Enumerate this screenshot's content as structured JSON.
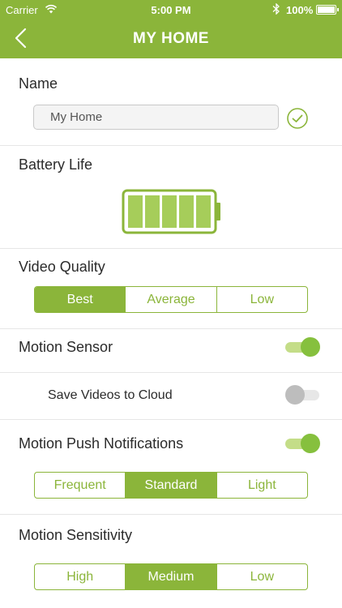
{
  "status_bar": {
    "carrier": "Carrier",
    "time": "5:00 PM",
    "battery_percent": "100%"
  },
  "header": {
    "title": "MY HOME",
    "back_icon": "chevron-left-icon"
  },
  "name_section": {
    "label": "Name",
    "value": "My Home",
    "confirm_icon": "check-circle-icon"
  },
  "battery_section": {
    "label": "Battery Life",
    "level_bars": 5,
    "filled_bars": 5
  },
  "video_quality": {
    "label": "Video Quality",
    "options": [
      "Best",
      "Average",
      "Low"
    ],
    "selected": "Best"
  },
  "motion_sensor": {
    "label": "Motion Sensor",
    "enabled": true
  },
  "save_videos": {
    "label": "Save Videos to Cloud",
    "enabled": false
  },
  "motion_push": {
    "label": "Motion Push Notifications",
    "enabled": true,
    "options": [
      "Frequent",
      "Standard",
      "Light"
    ],
    "selected": "Standard"
  },
  "motion_sensitivity": {
    "label": "Motion Sensitivity",
    "options": [
      "High",
      "Medium",
      "Low"
    ],
    "selected": "Medium"
  },
  "colors": {
    "accent": "#8bb53a",
    "toggle_on": "#86c03e",
    "toggle_off": "#bdbdbd"
  }
}
